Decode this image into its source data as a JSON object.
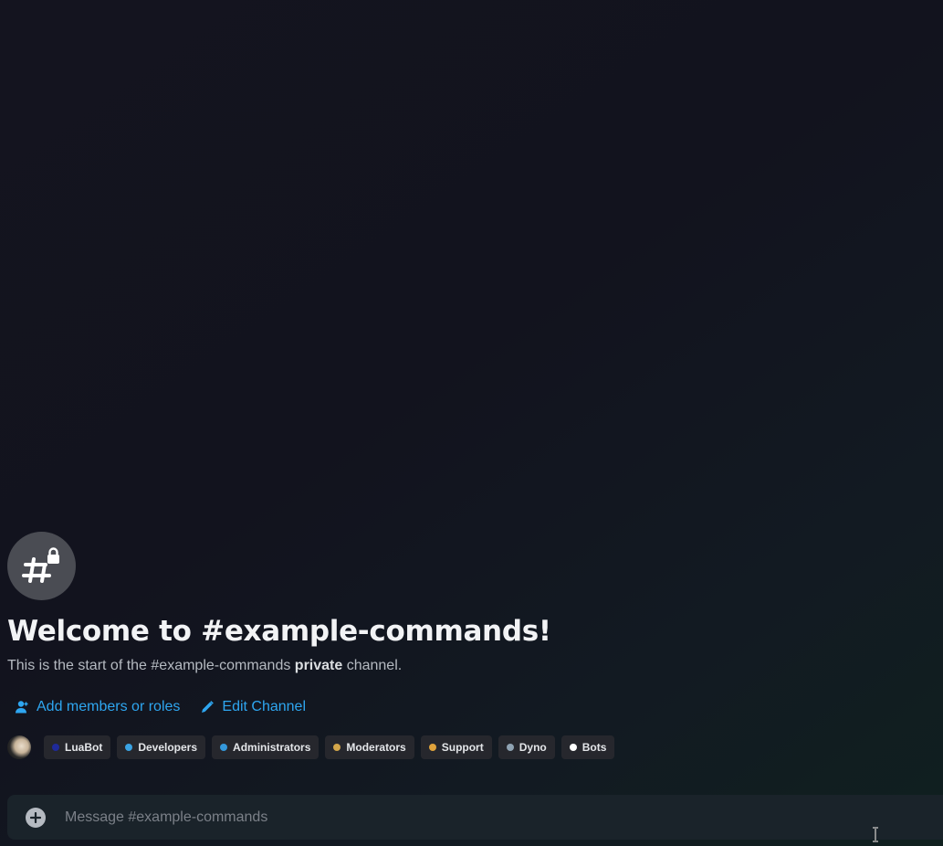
{
  "welcome": {
    "title": "Welcome to #example-commands!",
    "subtitle_prefix": "This is the start of the #example-commands ",
    "subtitle_bold": "private",
    "subtitle_suffix": " channel."
  },
  "actions": {
    "add_members_label": "Add members or roles",
    "edit_channel_label": "Edit Channel"
  },
  "roles": [
    {
      "label": "LuaBot",
      "color": "#1f2a9a"
    },
    {
      "label": "Developers",
      "color": "#3aa3e3"
    },
    {
      "label": "Administrators",
      "color": "#3498db"
    },
    {
      "label": "Moderators",
      "color": "#d4a64a"
    },
    {
      "label": "Support",
      "color": "#e0a33c"
    },
    {
      "label": "Dyno",
      "color": "#8fa3b3"
    },
    {
      "label": "Bots",
      "color": "#ffffff"
    }
  ],
  "composer": {
    "placeholder": "Message #example-commands"
  },
  "colors": {
    "link": "#2ea6f0",
    "icon_bg": "#4a4c53"
  }
}
